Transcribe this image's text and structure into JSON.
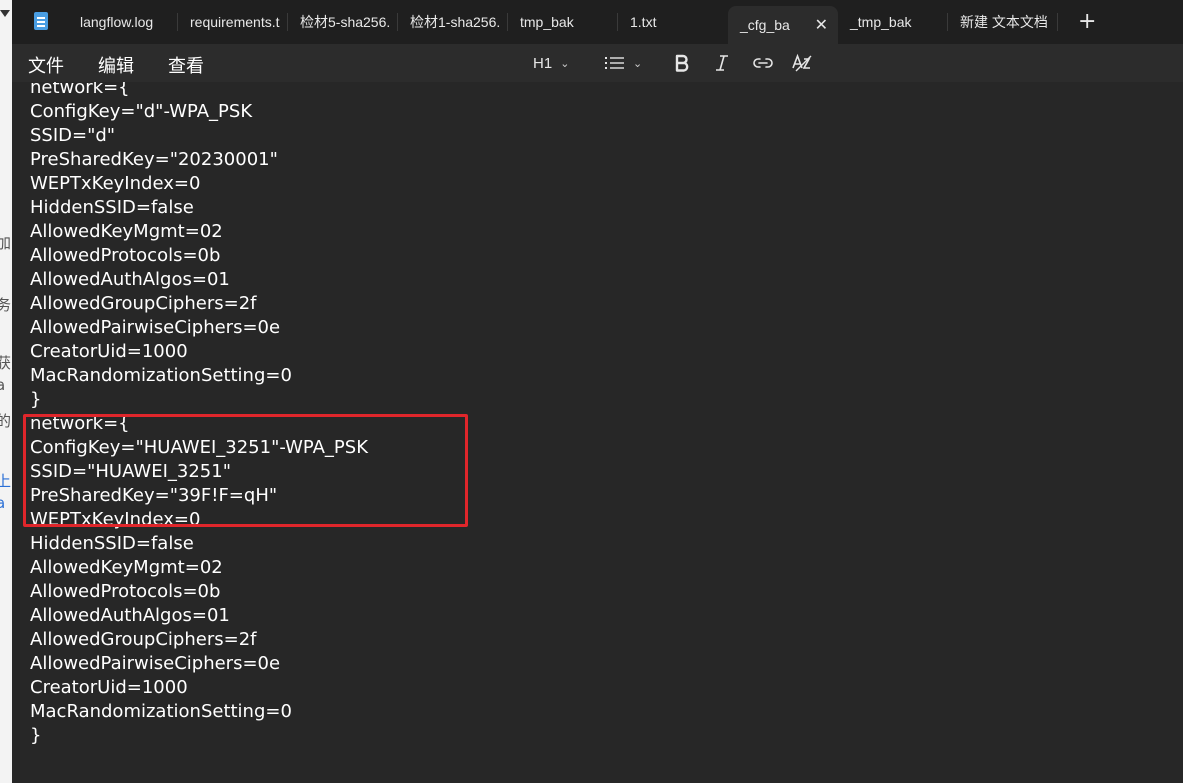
{
  "tabs": [
    {
      "label": "langflow.log"
    },
    {
      "label": "requirements.t"
    },
    {
      "label": "检材5-sha256."
    },
    {
      "label": "检材1-sha256."
    },
    {
      "label": "tmp_bak"
    },
    {
      "label": "1.txt"
    },
    {
      "label": "_cfg_ba",
      "active": true
    },
    {
      "label": "_tmp_bak"
    },
    {
      "label": "新建 文本文档"
    }
  ],
  "tab_close_glyph": "✕",
  "new_tab_glyph": "+",
  "menu": {
    "file": "文件",
    "edit": "编辑",
    "view": "查看"
  },
  "format_toolbar": {
    "heading": "H1",
    "list_icon": "bulleted-list-icon",
    "bold_icon": "bold-icon",
    "italic_icon": "italic-icon",
    "link_icon": "link-icon",
    "clear_format_icon": "clear-formatting-icon"
  },
  "editor_lines": [
    "network={",
    "ConfigKey=\"d\"-WPA_PSK",
    "SSID=\"d\"",
    "PreSharedKey=\"20230001\"",
    "WEPTxKeyIndex=0",
    "HiddenSSID=false",
    "AllowedKeyMgmt=02",
    "AllowedProtocols=0b",
    "AllowedAuthAlgos=01",
    "AllowedGroupCiphers=2f",
    "AllowedPairwiseCiphers=0e",
    "CreatorUid=1000",
    "MacRandomizationSetting=0",
    "}",
    "network={",
    "ConfigKey=\"HUAWEI_3251\"-WPA_PSK",
    "SSID=\"HUAWEI_3251\"",
    "PreSharedKey=\"39F!F=qH\"",
    "WEPTxKeyIndex=0",
    "HiddenSSID=false",
    "AllowedKeyMgmt=02",
    "AllowedProtocols=0b",
    "AllowedAuthAlgos=01",
    "AllowedGroupCiphers=2f",
    "AllowedPairwiseCiphers=0e",
    "CreatorUid=1000",
    "MacRandomizationSetting=0",
    "}"
  ],
  "colors": {
    "highlight_border": "#e0262b",
    "background": "#272727",
    "text": "#ffffff"
  }
}
